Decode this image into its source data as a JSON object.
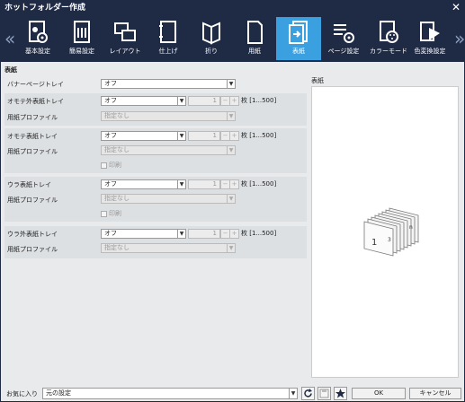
{
  "window": {
    "title": "ホットフォルダー作成"
  },
  "toolbar": {
    "items": [
      {
        "label": "基本設定"
      },
      {
        "label": "簡易設定"
      },
      {
        "label": "レイアウト"
      },
      {
        "label": "仕上げ"
      },
      {
        "label": "折り"
      },
      {
        "label": "用紙"
      },
      {
        "label": "表紙"
      },
      {
        "label": "ページ設定"
      },
      {
        "label": "カラーモード"
      },
      {
        "label": "色変換設定"
      }
    ],
    "active_index": 6
  },
  "section": {
    "title": "表紙"
  },
  "banner": {
    "label": "バナーページトレイ",
    "value": "オフ"
  },
  "front_outer": {
    "label": "オモテ外表紙トレイ",
    "value": "オフ",
    "count": "1",
    "unit_range": "枚 [1...500]",
    "profile_label": "用紙プロファイル",
    "profile_value": "指定なし"
  },
  "front": {
    "label": "オモテ表紙トレイ",
    "value": "オフ",
    "count": "1",
    "unit_range": "枚 [1...500]",
    "profile_label": "用紙プロファイル",
    "profile_value": "指定なし",
    "print_label": "印刷"
  },
  "back": {
    "label": "ウラ表紙トレイ",
    "value": "オフ",
    "count": "1",
    "unit_range": "枚 [1...500]",
    "profile_label": "用紙プロファイル",
    "profile_value": "指定なし",
    "print_label": "印刷"
  },
  "back_outer": {
    "label": "ウラ外表紙トレイ",
    "value": "オフ",
    "count": "1",
    "unit_range": "枚 [1...500]",
    "profile_label": "用紙プロファイル",
    "profile_value": "指定なし"
  },
  "preview": {
    "title": "表紙",
    "page_first": "1",
    "page_second": "3",
    "page_last": "n"
  },
  "footer": {
    "favorites_label": "お気に入り",
    "favorites_value": "元の設定",
    "ok_label": "OK",
    "cancel_label": "キャンセル"
  },
  "colors": {
    "titlebar": "#1f2a44",
    "active_tab": "#3aa0e0"
  }
}
